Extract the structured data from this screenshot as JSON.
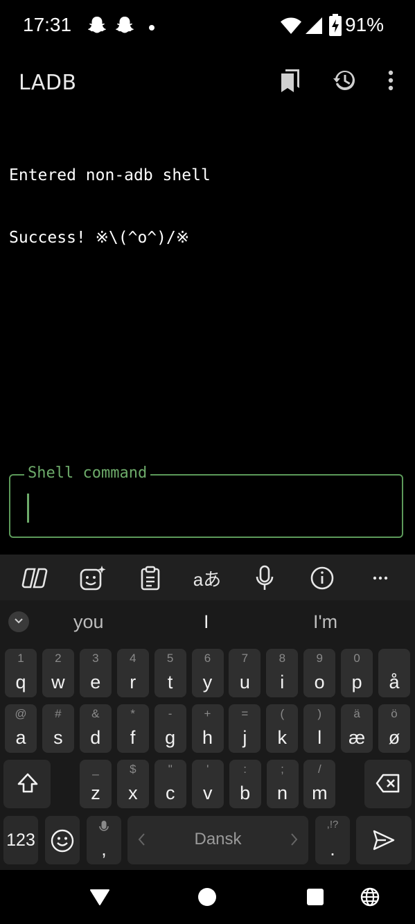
{
  "status_bar": {
    "time": "17:31",
    "battery_percent": "91%",
    "icons": [
      "snapchat-icon",
      "snapchat-icon",
      "dot-icon",
      "wifi-icon",
      "signal-icon",
      "battery-charging-icon"
    ]
  },
  "app_bar": {
    "title": "LADB",
    "actions": [
      "bookmarks-icon",
      "history-icon",
      "more-vert-icon"
    ]
  },
  "console": {
    "lines": [
      "Entered non-adb shell",
      "Success! ※\\(^o^)/※"
    ]
  },
  "shell_input": {
    "label": "Shell command",
    "value": "",
    "accent_color": "#5c9a5a"
  },
  "keyboard": {
    "toolbar": [
      "copilot-icon",
      "sticker-icon",
      "clipboard-icon",
      "translate-icon",
      "microphone-icon",
      "info-icon",
      "more-horiz-icon"
    ],
    "suggestions": [
      "you",
      "I",
      "I'm"
    ],
    "row1": [
      {
        "main": "q",
        "alt": "1"
      },
      {
        "main": "w",
        "alt": "2"
      },
      {
        "main": "e",
        "alt": "3"
      },
      {
        "main": "r",
        "alt": "4"
      },
      {
        "main": "t",
        "alt": "5"
      },
      {
        "main": "y",
        "alt": "6"
      },
      {
        "main": "u",
        "alt": "7"
      },
      {
        "main": "i",
        "alt": "8"
      },
      {
        "main": "o",
        "alt": "9"
      },
      {
        "main": "p",
        "alt": "0"
      },
      {
        "main": "å",
        "alt": ""
      }
    ],
    "row2": [
      {
        "main": "a",
        "alt": "@"
      },
      {
        "main": "s",
        "alt": "#"
      },
      {
        "main": "d",
        "alt": "&"
      },
      {
        "main": "f",
        "alt": "*"
      },
      {
        "main": "g",
        "alt": "-"
      },
      {
        "main": "h",
        "alt": "+"
      },
      {
        "main": "j",
        "alt": "="
      },
      {
        "main": "k",
        "alt": "("
      },
      {
        "main": "l",
        "alt": ")"
      },
      {
        "main": "æ",
        "alt": "ä"
      },
      {
        "main": "ø",
        "alt": "ö"
      }
    ],
    "row3": [
      {
        "main": "z",
        "alt": "_"
      },
      {
        "main": "x",
        "alt": "$"
      },
      {
        "main": "c",
        "alt": "\""
      },
      {
        "main": "v",
        "alt": "'"
      },
      {
        "main": "b",
        "alt": ":"
      },
      {
        "main": "n",
        "alt": ";"
      },
      {
        "main": "m",
        "alt": "/"
      }
    ],
    "numbers_key": "123",
    "comma_key": ",",
    "period_key": ".",
    "period_alt": ",!?",
    "space_language": "Dansk"
  },
  "nav_bar": [
    "back-icon",
    "home-icon",
    "recents-icon",
    "globe-icon"
  ]
}
